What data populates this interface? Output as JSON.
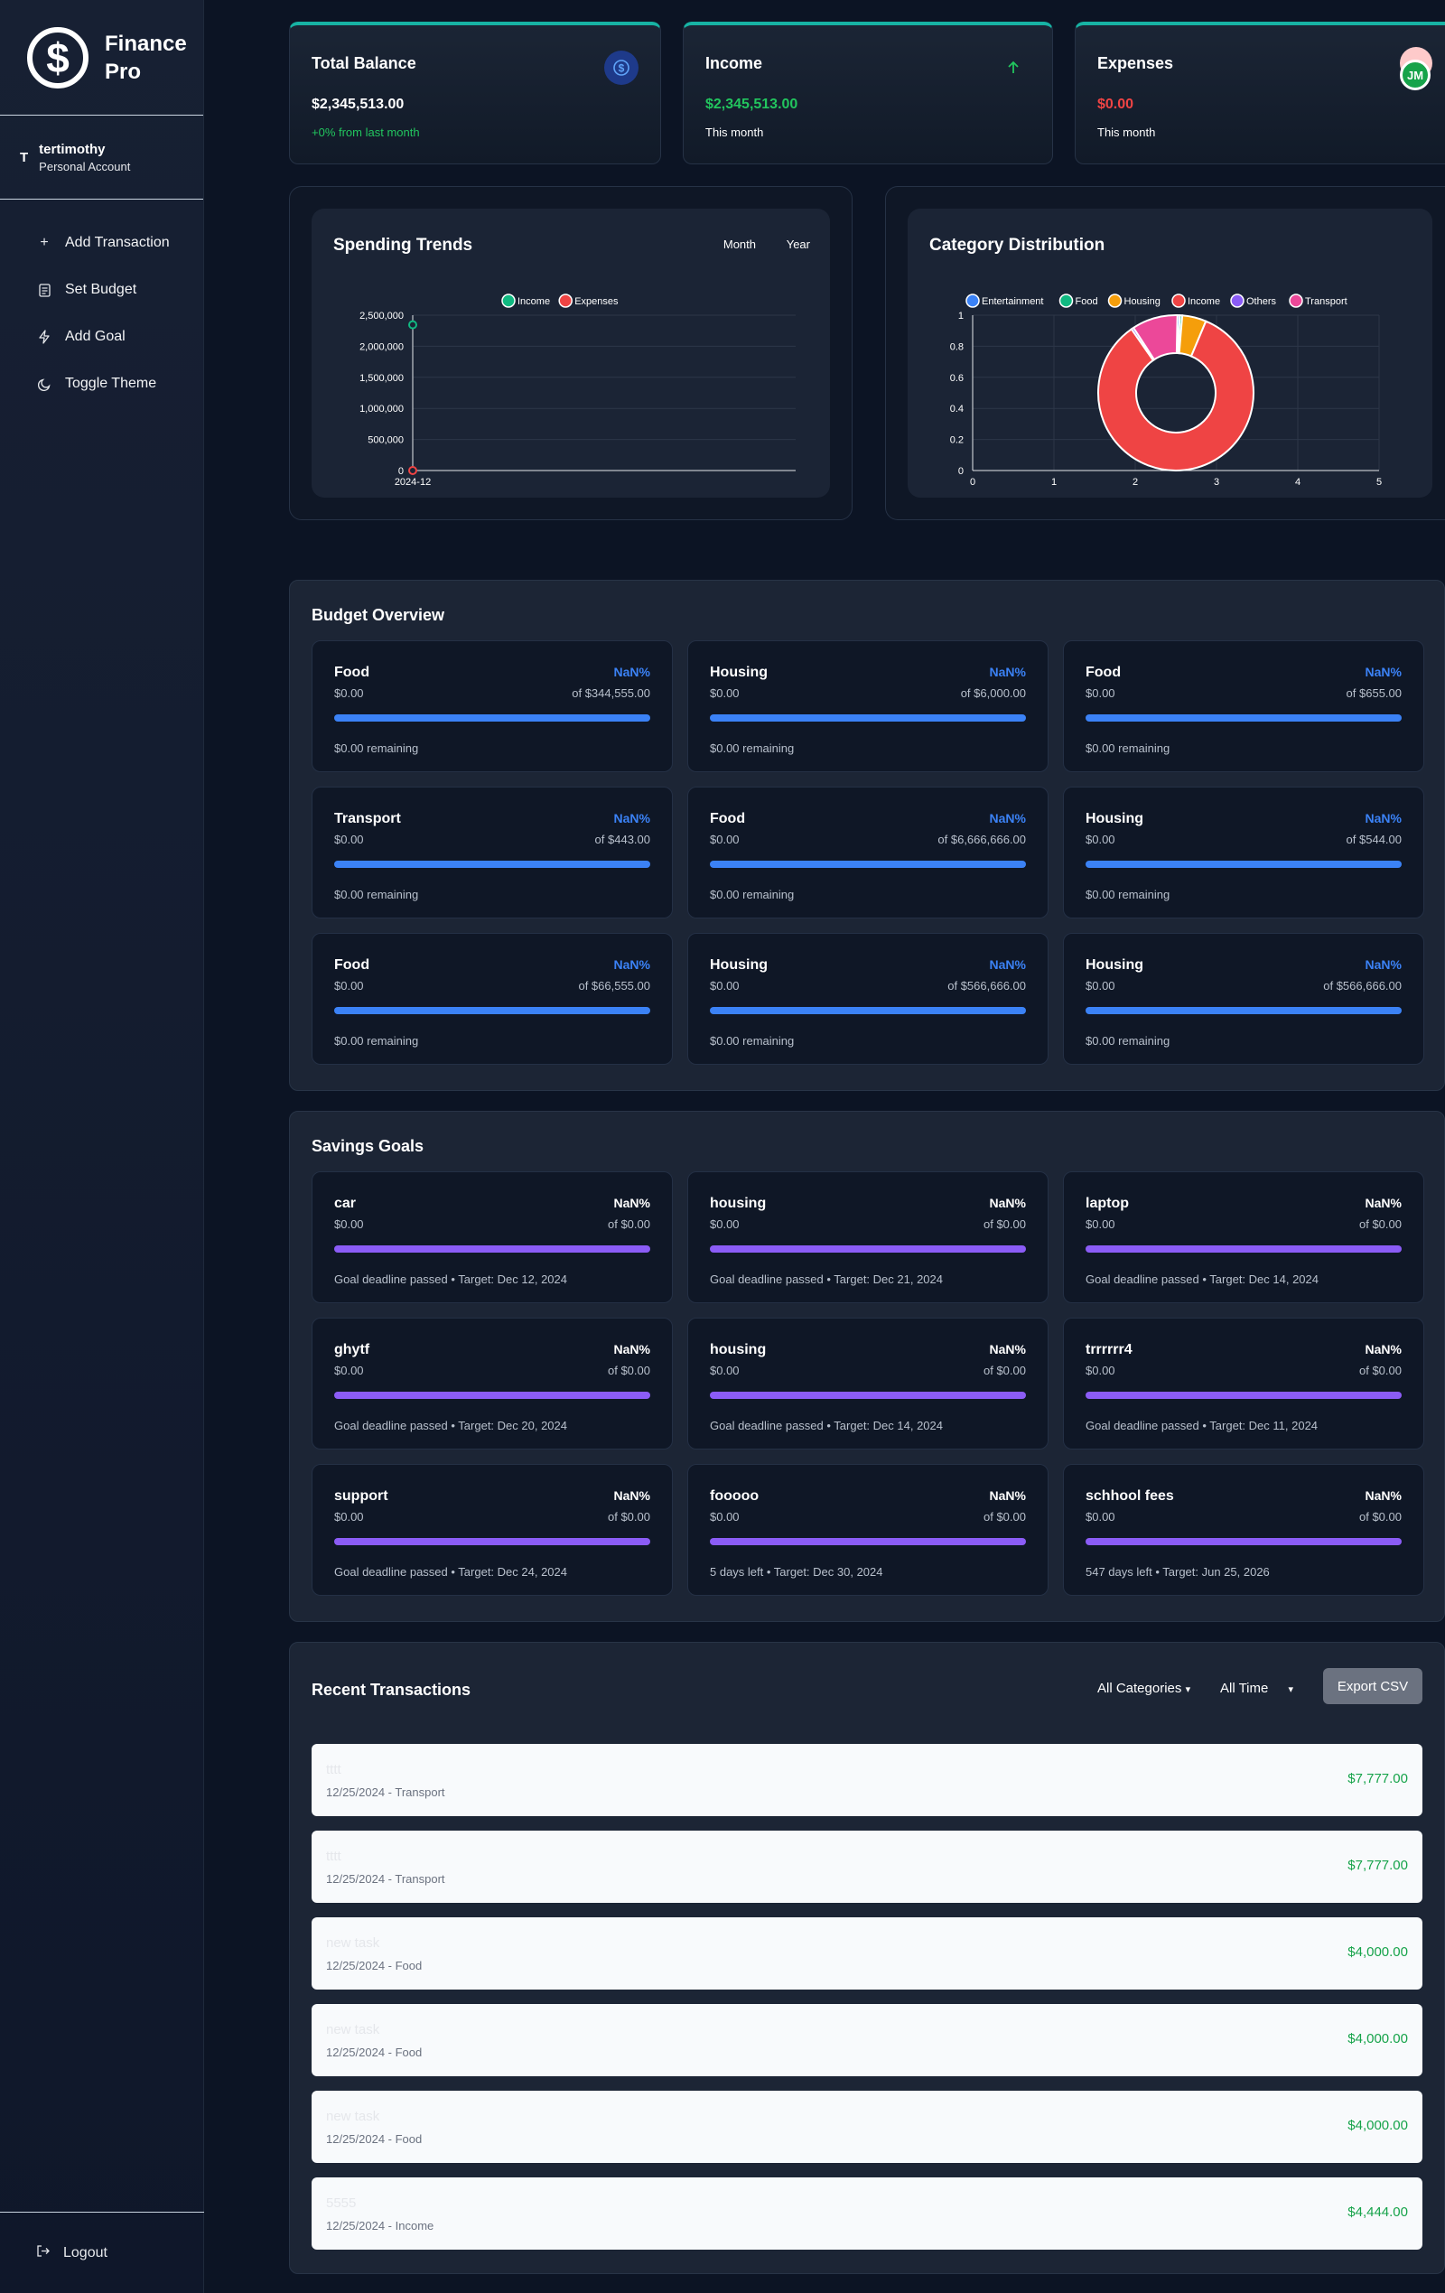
{
  "brand": {
    "logo_glyph": "$",
    "name": "Finance Pro"
  },
  "user": {
    "initial": "T",
    "name": "tertimothy",
    "account": "Personal Account"
  },
  "nav": [
    {
      "label": "Add Transaction",
      "icon": "plus-icon"
    },
    {
      "label": "Set Budget",
      "icon": "document-icon"
    },
    {
      "label": "Add Goal",
      "icon": "lightning-icon"
    },
    {
      "label": "Toggle Theme",
      "icon": "moon-icon"
    }
  ],
  "logout_label": "Logout",
  "stats": {
    "balance": {
      "title": "Total Balance",
      "value": "$2,345,513.00",
      "sub": "+0% from last month",
      "icon": "dollar-icon"
    },
    "income": {
      "title": "Income",
      "value": "$2,345,513.00",
      "sub": "This month",
      "icon": "arrow-up-icon"
    },
    "expenses": {
      "title": "Expenses",
      "value": "$0.00",
      "sub": "This month",
      "icon": "arrow-down-icon"
    }
  },
  "avatar_text": "JM",
  "spending": {
    "title": "Spending Trends",
    "toggle_month": "Month",
    "toggle_year": "Year"
  },
  "category": {
    "title": "Category Distribution"
  },
  "chart_data": [
    {
      "type": "line",
      "title": "Spending Trends",
      "x": [
        "2024-12"
      ],
      "yticks": [
        "0",
        "500,000",
        "1,000,000",
        "1,500,000",
        "2,000,000",
        "2,500,000"
      ],
      "ylim": [
        0,
        2500000
      ],
      "series": [
        {
          "name": "Income",
          "values": [
            2345513
          ],
          "color": "#10b981"
        },
        {
          "name": "Expenses",
          "values": [
            0
          ],
          "color": "#ef4444"
        }
      ],
      "legend": "top",
      "grid": true
    },
    {
      "type": "pie",
      "title": "Category Distribution",
      "labels": [
        "Entertainment",
        "Food",
        "Housing",
        "Income",
        "Others",
        "Transport"
      ],
      "colors": [
        "#3b82f6",
        "#10b981",
        "#f59e0b",
        "#ef4444",
        "#8b5cf6",
        "#ec4899"
      ],
      "values": [
        0.5,
        0.5,
        5,
        84,
        0.5,
        9.5
      ],
      "xticks": [
        "0",
        "1",
        "2",
        "3",
        "4",
        "5"
      ],
      "yticks": [
        "0",
        "0.2",
        "0.4",
        "0.6",
        "0.8",
        "1"
      ],
      "legend": "top",
      "grid": true
    }
  ],
  "budget": {
    "title": "Budget Overview",
    "items": [
      {
        "name": "Food",
        "pct": "NaN%",
        "spent": "$0.00",
        "of": "of $344,555.00",
        "remaining": "$0.00 remaining"
      },
      {
        "name": "Housing",
        "pct": "NaN%",
        "spent": "$0.00",
        "of": "of $6,000.00",
        "remaining": "$0.00 remaining"
      },
      {
        "name": "Food",
        "pct": "NaN%",
        "spent": "$0.00",
        "of": "of $655.00",
        "remaining": "$0.00 remaining"
      },
      {
        "name": "Transport",
        "pct": "NaN%",
        "spent": "$0.00",
        "of": "of $443.00",
        "remaining": "$0.00 remaining"
      },
      {
        "name": "Food",
        "pct": "NaN%",
        "spent": "$0.00",
        "of": "of $6,666,666.00",
        "remaining": "$0.00 remaining"
      },
      {
        "name": "Housing",
        "pct": "NaN%",
        "spent": "$0.00",
        "of": "of $544.00",
        "remaining": "$0.00 remaining"
      },
      {
        "name": "Food",
        "pct": "NaN%",
        "spent": "$0.00",
        "of": "of $66,555.00",
        "remaining": "$0.00 remaining"
      },
      {
        "name": "Housing",
        "pct": "NaN%",
        "spent": "$0.00",
        "of": "of $566,666.00",
        "remaining": "$0.00 remaining"
      },
      {
        "name": "Housing",
        "pct": "NaN%",
        "spent": "$0.00",
        "of": "of $566,666.00",
        "remaining": "$0.00 remaining"
      }
    ]
  },
  "goals": {
    "title": "Savings Goals",
    "items": [
      {
        "name": "car",
        "pct": "NaN%",
        "saved": "$0.00",
        "of": "of $0.00",
        "foot": "Goal deadline passed • Target: Dec 12, 2024"
      },
      {
        "name": "housing",
        "pct": "NaN%",
        "saved": "$0.00",
        "of": "of $0.00",
        "foot": "Goal deadline passed • Target: Dec 21, 2024"
      },
      {
        "name": "laptop",
        "pct": "NaN%",
        "saved": "$0.00",
        "of": "of $0.00",
        "foot": "Goal deadline passed • Target: Dec 14, 2024"
      },
      {
        "name": "ghytf",
        "pct": "NaN%",
        "saved": "$0.00",
        "of": "of $0.00",
        "foot": "Goal deadline passed • Target: Dec 20, 2024"
      },
      {
        "name": "housing",
        "pct": "NaN%",
        "saved": "$0.00",
        "of": "of $0.00",
        "foot": "Goal deadline passed • Target: Dec 14, 2024"
      },
      {
        "name": "trrrrrr4",
        "pct": "NaN%",
        "saved": "$0.00",
        "of": "of $0.00",
        "foot": "Goal deadline passed • Target: Dec 11, 2024"
      },
      {
        "name": "support",
        "pct": "NaN%",
        "saved": "$0.00",
        "of": "of $0.00",
        "foot": "Goal deadline passed • Target: Dec 24, 2024"
      },
      {
        "name": "fooooo",
        "pct": "NaN%",
        "saved": "$0.00",
        "of": "of $0.00",
        "foot": "5 days left • Target: Dec 30, 2024"
      },
      {
        "name": "schhool fees",
        "pct": "NaN%",
        "saved": "$0.00",
        "of": "of $0.00",
        "foot": "547 days left • Target: Jun 25, 2026"
      }
    ]
  },
  "transactions": {
    "title": "Recent Transactions",
    "filter_category": "All Categories",
    "filter_time": "All Time",
    "export_label": "Export CSV",
    "items": [
      {
        "desc": "tttt",
        "meta": "12/25/2024 - Transport",
        "amount": "$7,777.00"
      },
      {
        "desc": "tttt",
        "meta": "12/25/2024 - Transport",
        "amount": "$7,777.00"
      },
      {
        "desc": "new task",
        "meta": "12/25/2024 - Food",
        "amount": "$4,000.00"
      },
      {
        "desc": "new task",
        "meta": "12/25/2024 - Food",
        "amount": "$4,000.00"
      },
      {
        "desc": "new task",
        "meta": "12/25/2024 - Food",
        "amount": "$4,000.00"
      },
      {
        "desc": "5555",
        "meta": "12/25/2024 - Income",
        "amount": "$4,444.00"
      }
    ]
  },
  "colors": {
    "accent_teal": "#17b3a4",
    "income_green": "#22c55e",
    "expense_red": "#ef4444",
    "budget_blue": "#3b82f6",
    "goal_purple": "#8b5cf6"
  }
}
